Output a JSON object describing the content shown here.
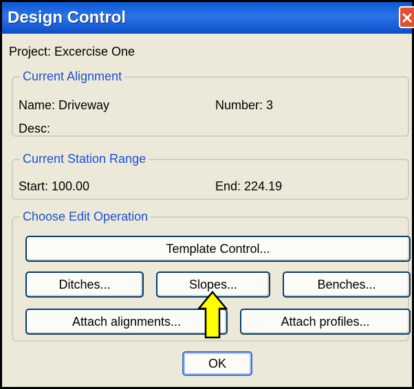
{
  "window": {
    "title": "Design Control",
    "colors": {
      "titlebar": "#0a5bd6",
      "body": "#ece9d8",
      "group_text": "#1e50d8",
      "close": "#e0512d",
      "arrow": "#ffff00"
    }
  },
  "project": {
    "label": "Project: Excercise One"
  },
  "current_alignment": {
    "legend": "Current Alignment",
    "name": "Name: Driveway",
    "number": "Number: 3",
    "desc": "Desc:"
  },
  "station_range": {
    "legend": "Current Station Range",
    "start": "Start: 100.00",
    "end": "End: 224.19"
  },
  "edit_operation": {
    "legend": "Choose Edit Operation",
    "buttons": {
      "template_control": "Template Control...",
      "ditches": "Ditches...",
      "slopes": "Slopes...",
      "benches": "Benches...",
      "attach_alignments": "Attach alignments...",
      "attach_profiles": "Attach profiles..."
    }
  },
  "footer": {
    "ok": "OK"
  },
  "icons": {
    "close": "close-icon",
    "pointer": "up-arrow-icon"
  }
}
